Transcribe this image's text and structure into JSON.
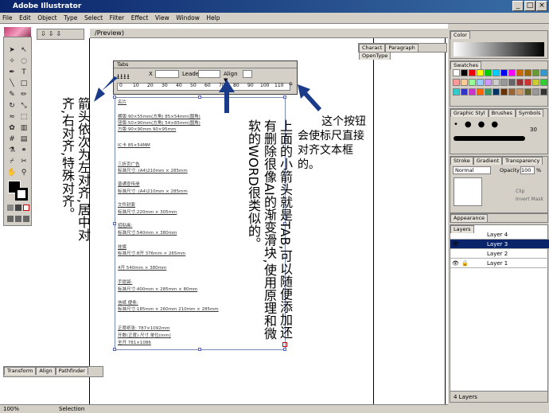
{
  "window": {
    "title": "Adobe Illustrator",
    "min": "_",
    "max": "□",
    "close": "×"
  },
  "menu": [
    "File",
    "Edit",
    "Object",
    "Type",
    "Select",
    "Filter",
    "Effect",
    "View",
    "Window",
    "Help"
  ],
  "document": {
    "tab_title": "/Preview)"
  },
  "tabs_dialog": {
    "title": "Tabs",
    "x_label": "X",
    "leader_label": "Leader",
    "align_label": "Align",
    "ruler_numbers": [
      "0",
      "10",
      "20",
      "30",
      "40",
      "50",
      "60",
      "70",
      "80",
      "90",
      "100",
      "110"
    ]
  },
  "content_lines": [
    "名片",
    "横版:90×55mm(方角) 85×54mm(圆角)",
    "竖版:50×90mm(方角) 54×85mm(圆角)",
    "方版:90×90mm 90×95mm",
    "IC卡   85×54MM",
    "三折页广告",
    "标准尺寸: (A4)210mm × 285mm",
    "普通宣传册",
    "标准尺寸: (A4)210mm × 285mm",
    "文件封套",
    "标准尺寸:220mm × 305mm",
    "招贴画:",
    "标准尺寸:540mm × 380mm",
    "挂旗",
    "标准尺寸:8开 376mm × 265mm",
    "4开 540mm × 380mm",
    "手提袋:",
    "标准尺寸:400mm × 285mm × 80mm",
    "信纸 便条:",
    "标准尺寸:185mm × 260mm 210mm × 285mm",
    "正度纸张: 787×1092mm",
    "开数(正度) 尺寸 单位(mm)",
    "全开 781×1086"
  ],
  "annotations": {
    "left": [
      "中对齐,右对齐,特殊对齐。",
      "箭头依次为左对齐,居"
    ],
    "middle": [
      "上面的小箭头就是TAB,可以随便添",
      "加还有删除很像AI的渐变滑块,使用原理",
      "和微软的WORD很类似的。"
    ],
    "right": [
      "这个按钮",
      "会使标尺直接",
      "对齐文本框",
      "的。"
    ]
  },
  "panels": {
    "top_tabs": [
      "Charact",
      "Paragraph",
      "OpenType"
    ],
    "color": "Color",
    "swatches": "Swatches",
    "styles_tabs": [
      "Graphic Styl",
      "Brushes",
      "Symbols"
    ],
    "brush_size": "30",
    "stroke_tabs": [
      "Stroke",
      "Gradient",
      "Transparency"
    ],
    "blend_mode": "Normal",
    "opacity_label": "Opacity",
    "opacity_value": "100",
    "opacity_unit": "%",
    "clip": "Clip",
    "invert_mask": "Invert Mask",
    "appearance": "Appearance",
    "layers_title": "Layers",
    "layers": [
      "Layer 4",
      "Layer 3",
      "Layer 2",
      "Layer 1"
    ],
    "layer_count": "4 Layers",
    "bottom_tabs": [
      "Transform",
      "Align",
      "Pathfinder"
    ]
  },
  "status": {
    "zoom": "100%",
    "tool": "Selection"
  },
  "colors": {
    "title_bar": "#0a246a",
    "selected_layer": "#0a246a",
    "arrow": "#1a3a8a"
  }
}
